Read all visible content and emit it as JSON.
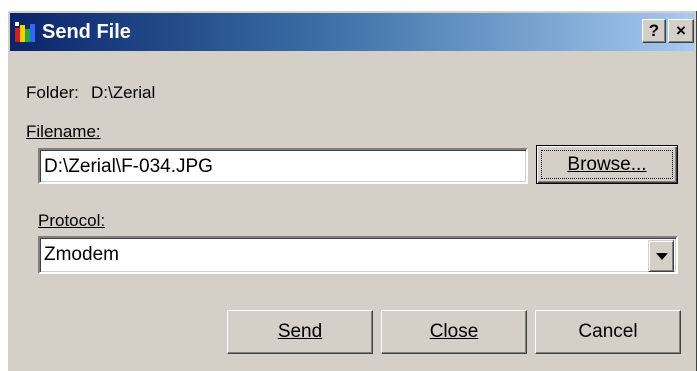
{
  "window": {
    "title": "Send File",
    "help_label": "?",
    "close_label": "×"
  },
  "folder": {
    "label": "Folder:",
    "path": "D:\\Zerial"
  },
  "filename": {
    "label": "Filename:",
    "value": "D:\\Zerial\\F-034.JPG",
    "browse_label": "Browse..."
  },
  "protocol": {
    "label": "Protocol:",
    "selected": "Zmodem"
  },
  "buttons": {
    "send": "Send",
    "close": "Close",
    "cancel": "Cancel"
  },
  "colors": {
    "titlebar_start": "#0a246a",
    "titlebar_end": "#a6caf0",
    "face": "#d4d0c8"
  },
  "icons": {
    "app": "send-file-app-icon",
    "dropdown": "chevron-down-icon"
  }
}
